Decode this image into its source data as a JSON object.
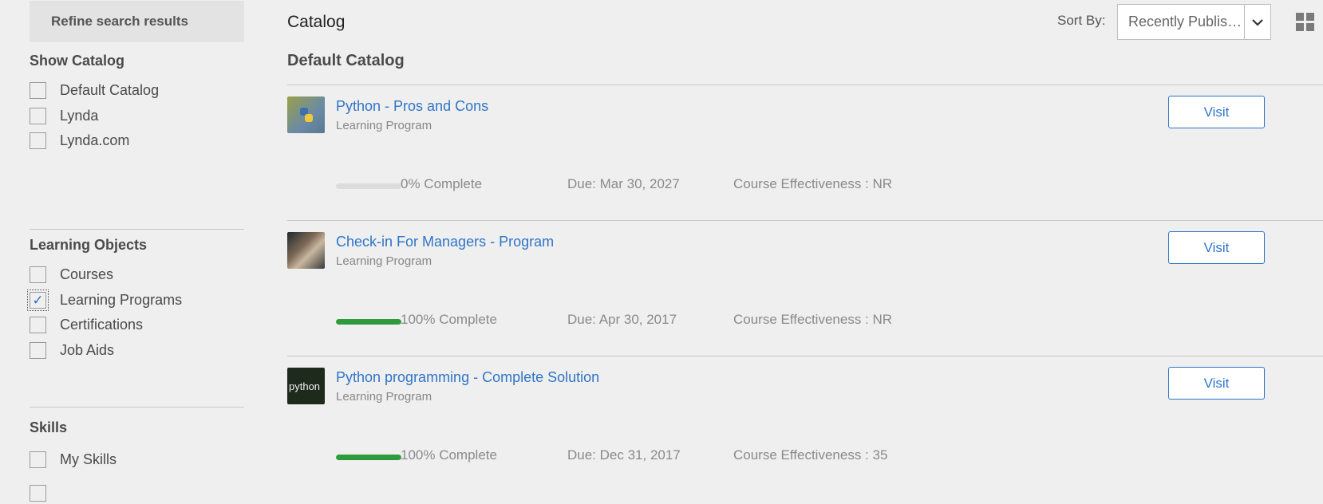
{
  "sidebar": {
    "refine_label": "Refine search results",
    "show_catalog": {
      "title": "Show Catalog",
      "options": [
        {
          "label": "Default Catalog",
          "checked": false
        },
        {
          "label": "Lynda",
          "checked": false
        },
        {
          "label": "Lynda.com",
          "checked": false
        }
      ]
    },
    "learning_objects": {
      "title": "Learning Objects",
      "options": [
        {
          "label": "Courses",
          "checked": false
        },
        {
          "label": "Learning Programs",
          "checked": true
        },
        {
          "label": "Certifications",
          "checked": false
        },
        {
          "label": "Job Aids",
          "checked": false
        }
      ]
    },
    "skills": {
      "title": "Skills",
      "options": [
        {
          "label": "My Skills",
          "checked": false
        }
      ]
    }
  },
  "header": {
    "title": "Catalog",
    "sort_label": "Sort By:",
    "sort_value": "Recently Published",
    "grid_icon": "grid-view-icon"
  },
  "catalog": {
    "name": "Default Catalog",
    "items": [
      {
        "title": "Python - Pros and Cons",
        "type": "Learning Program",
        "visit_label": "Visit",
        "progress": 0,
        "complete_text": "0% Complete",
        "due_text": "Due: Mar 30, 2027",
        "effectiveness_text": "Course Effectiveness : NR"
      },
      {
        "title": "Check-in For Managers - Program",
        "type": "Learning Program",
        "visit_label": "Visit",
        "progress": 100,
        "complete_text": "100% Complete",
        "due_text": "Due: Apr 30, 2017",
        "effectiveness_text": "Course Effectiveness : NR"
      },
      {
        "title": "Python programming - Complete Solution",
        "type": "Learning Program",
        "visit_label": "Visit",
        "thumb_text": "python",
        "progress": 100,
        "complete_text": "100% Complete",
        "due_text": "Due: Dec 31, 2017",
        "effectiveness_text": "Course Effectiveness : 35"
      }
    ]
  },
  "colors": {
    "accent": "#2f75c7",
    "progress": "#2e9a3e",
    "background": "#efefef"
  }
}
